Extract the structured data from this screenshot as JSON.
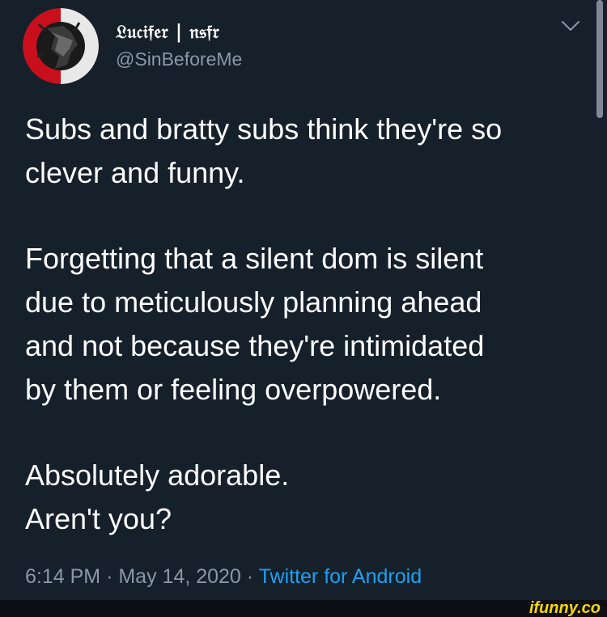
{
  "tweet": {
    "display_name": "𝔏𝔲𝔠𝔦𝔣𝔢𝔯 | 𝔫𝔰𝔣𝔯",
    "handle": "@SinBeforeMe",
    "paragraphs": [
      [
        "Subs and bratty subs think they're so",
        "clever and funny."
      ],
      [
        "Forgetting that a silent dom is silent",
        "due to meticulously planning ahead",
        "and not because they're intimidated",
        "by them or feeling overpowered."
      ],
      [
        "Absolutely adorable.",
        "Aren't you?"
      ]
    ],
    "time": "6:14 PM",
    "date": "May 14, 2020",
    "separator": "·",
    "source": "Twitter for Android"
  },
  "watermark": "ifunny.co",
  "icons": {
    "avatar": "avatar-image",
    "menu": "chevron-down-icon"
  },
  "colors": {
    "background": "#15202b",
    "text": "#ffffff",
    "secondary_text": "#8899a6",
    "link": "#1da1f2",
    "watermark": "#ffd800"
  }
}
